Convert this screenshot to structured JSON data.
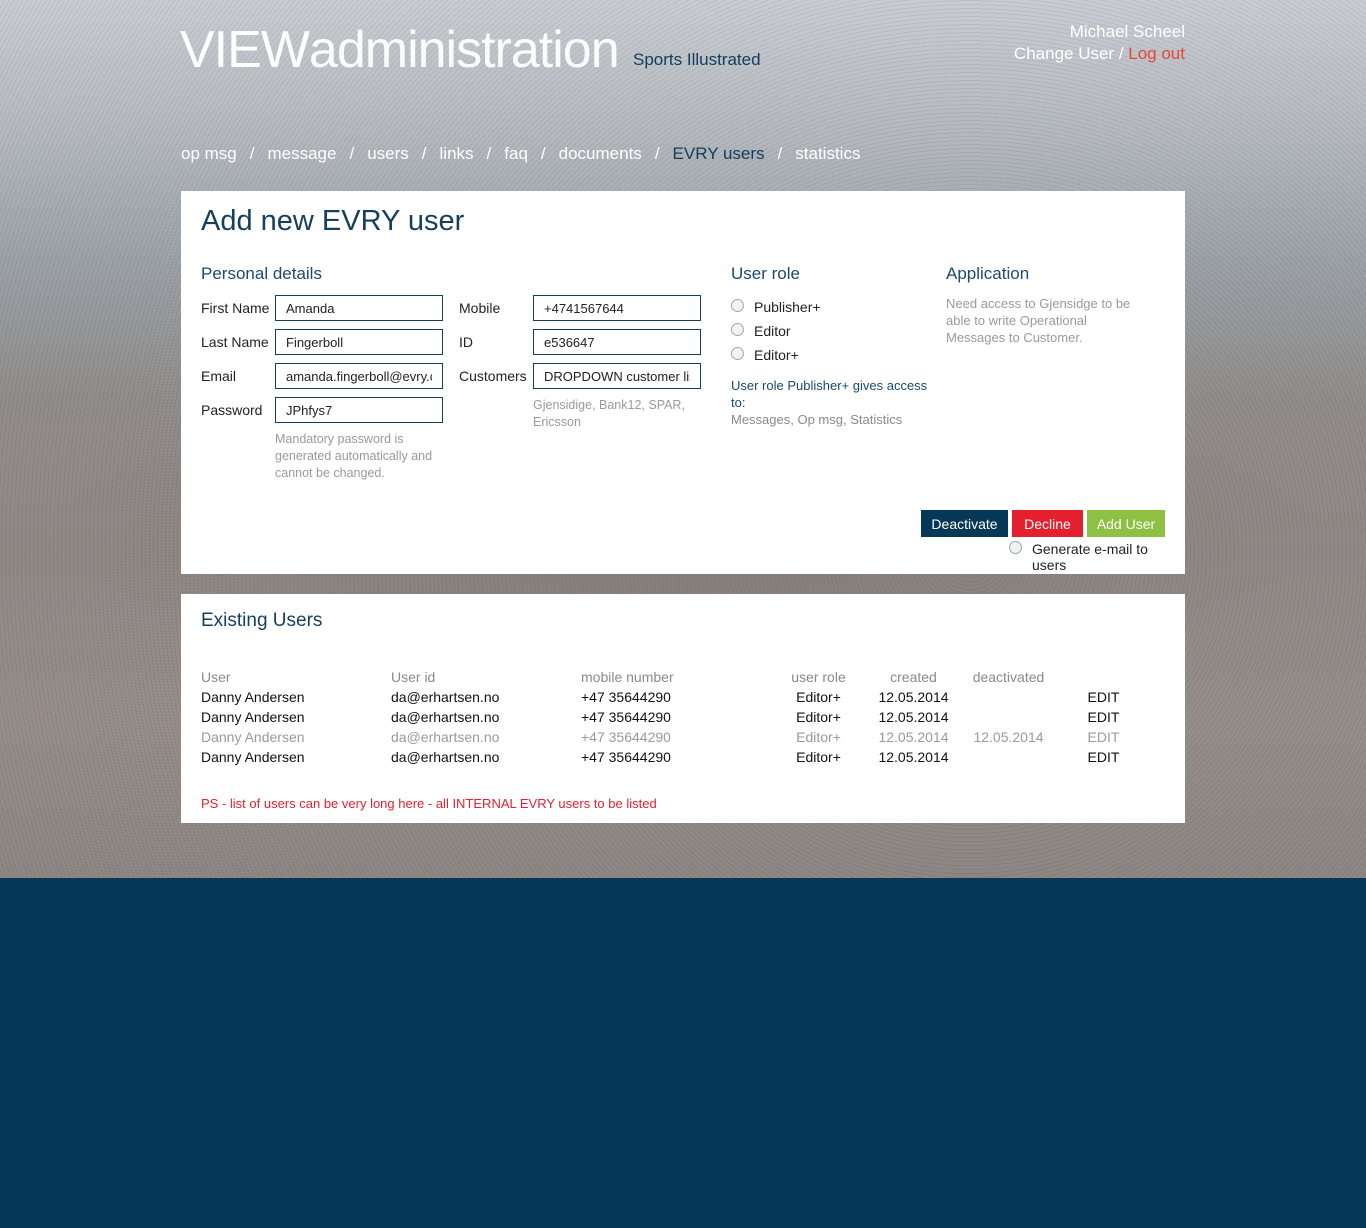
{
  "header": {
    "logo_bold": "VIEW",
    "logo_thin": "administration",
    "client": "Sports Illustrated",
    "user_name": "Michael Scheel",
    "change_user": "Change User",
    "slash": " / ",
    "logout": "Log out"
  },
  "nav": {
    "items": [
      "op msg",
      "message",
      "users",
      "links",
      "faq",
      "documents",
      "EVRY users",
      "statistics"
    ],
    "active": "EVRY users",
    "separator": "/"
  },
  "form": {
    "title": "Add new EVRY user",
    "personal_heading": "Personal details",
    "first_name_label": "First Name",
    "first_name_value": "Amanda",
    "last_name_label": "Last Name",
    "last_name_value": "Fingerboll",
    "email_label": "Email",
    "email_value": "amanda.fingerboll@evry.com",
    "password_label": "Password",
    "password_value": "JPhfys7",
    "password_note": "Mandatory password is generated automatically and cannot be changed.",
    "mobile_label": "Mobile",
    "mobile_value": "+4741567644",
    "id_label": "ID",
    "id_value": "e536647",
    "customers_label": "Customers",
    "customers_value": "DROPDOWN customer list",
    "customers_note": "Gjensidige, Bank12, SPAR, Ericsson",
    "role_heading": "User role",
    "roles": [
      "Publisher+",
      "Editor",
      "Editor+"
    ],
    "role_note_a": "User role Publisher+ gives access to:",
    "role_note_b": "Messages, Op msg, Statistics",
    "app_heading": "Application",
    "app_note": "Need access to Gjensidge to be able to write Operational Messages to Customer.",
    "deactivate": "Deactivate",
    "decline": "Decline",
    "add_user": "Add User",
    "generate_email": "Generate e-mail to users"
  },
  "existing": {
    "heading": "Existing Users",
    "columns": [
      "User",
      "User id",
      "mobile number",
      "user role",
      "created",
      "deactivated",
      ""
    ],
    "rows": [
      {
        "user": "Danny Andersen",
        "id": "da@erhartsen.no",
        "mobile": "+47 35644290",
        "role": "Editor+",
        "created": "12.05.2014",
        "deactivated": "",
        "edit": "EDIT"
      },
      {
        "user": "Danny Andersen",
        "id": "da@erhartsen.no",
        "mobile": "+47 35644290",
        "role": "Editor+",
        "created": "12.05.2014",
        "deactivated": "",
        "edit": "EDIT"
      },
      {
        "user": "Danny Andersen",
        "id": "da@erhartsen.no",
        "mobile": "+47 35644290",
        "role": "Editor+",
        "created": "12.05.2014",
        "deactivated": "12.05.2014",
        "edit": "EDIT"
      },
      {
        "user": "Danny Andersen",
        "id": "da@erhartsen.no",
        "mobile": "+47 35644290",
        "role": "Editor+",
        "created": "12.05.2014",
        "deactivated": "",
        "edit": "EDIT"
      }
    ],
    "note": "PS - list of users can be very long here - all INTERNAL EVRY users to be listed"
  },
  "colors": {
    "brand_navy": "#053857",
    "accent_red": "#e4202e",
    "accent_green": "#8dc043",
    "logout": "#e8463a"
  }
}
